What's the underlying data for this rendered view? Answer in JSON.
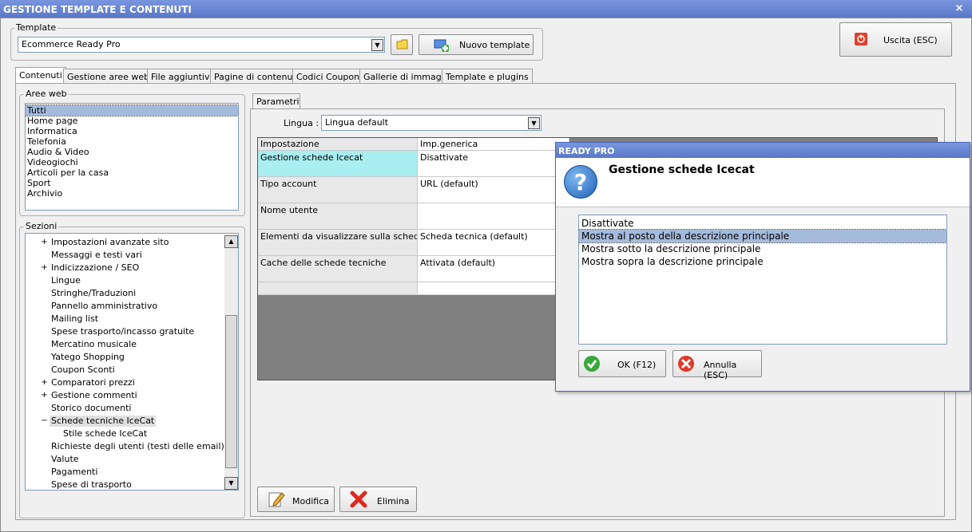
{
  "window": {
    "title": "GESTIONE TEMPLATE E CONTENUTI",
    "close_glyph": "×"
  },
  "template_group": {
    "label": "Template",
    "selected": "Ecommerce Ready Pro",
    "new_template_label": "Nuovo template"
  },
  "exit_button_label": "Uscita (ESC)",
  "tabs": [
    "Contenuti",
    "Gestione aree web",
    "File aggiuntivi",
    "Pagine di contenuti",
    "Codici Coupon",
    "Gallerie di immagini",
    "Template e plugins"
  ],
  "aree_web": {
    "label": "Aree web",
    "items": [
      "Tutti",
      "Home page",
      "Informatica",
      "Telefonia",
      "Audio & Video",
      "Videogiochi",
      "Articoli per la casa",
      "Sport",
      "Archivio"
    ]
  },
  "sezioni": {
    "label": "Sezioni",
    "items": [
      "Impostazioni avanzate sito",
      "Messaggi e testi vari",
      "Indicizzazione / SEO",
      "Lingue",
      "Stringhe/Traduzioni",
      "Pannello amministrativo",
      "Mailing list",
      "Spese trasporto/incasso gratuite",
      "Mercatino musicale",
      "Yatego Shopping",
      "Coupon Sconti",
      "Comparatori prezzi",
      "Gestione commenti",
      "Storico documenti",
      "Schede tecniche IceCat",
      "Stile schede IceCat",
      "Richieste degli utenti (testi delle email)",
      "Valute",
      "Pagamenti",
      "Spese di trasporto"
    ]
  },
  "parametri": {
    "tab_label": "Parametri",
    "lingua_label": "Lingua :",
    "lingua_value": "Lingua default",
    "columns": [
      "Impostazione",
      "Imp.generica"
    ],
    "rows": [
      [
        "Gestione schede Icecat",
        "Disattivate"
      ],
      [
        "Tipo account",
        "URL (default)"
      ],
      [
        "Nome utente",
        ""
      ],
      [
        "Elementi da visualizzare sulla scheda",
        "Scheda tecnica (default)"
      ],
      [
        "Cache delle schede tecniche",
        "Attivata (default)"
      ],
      [
        "",
        ""
      ]
    ],
    "modifica_label": "Modifica",
    "elimina_label": "Elimina"
  },
  "dialog": {
    "title": "READY PRO",
    "heading": "Gestione schede Icecat",
    "icon_glyph": "?",
    "options": [
      "Disattivate",
      "Mostra al posto della descrizione principale",
      "Mostra sotto la descrizione principale",
      "Mostra sopra la descrizione principale"
    ],
    "ok_label": "OK (F12)",
    "cancel_label": "Annulla (ESC)"
  },
  "colors": {
    "titlebar": "#6a87d4",
    "selection": "#a4bbdc",
    "highlight_cell": "#a9eef0",
    "dark_area": "#808080"
  }
}
